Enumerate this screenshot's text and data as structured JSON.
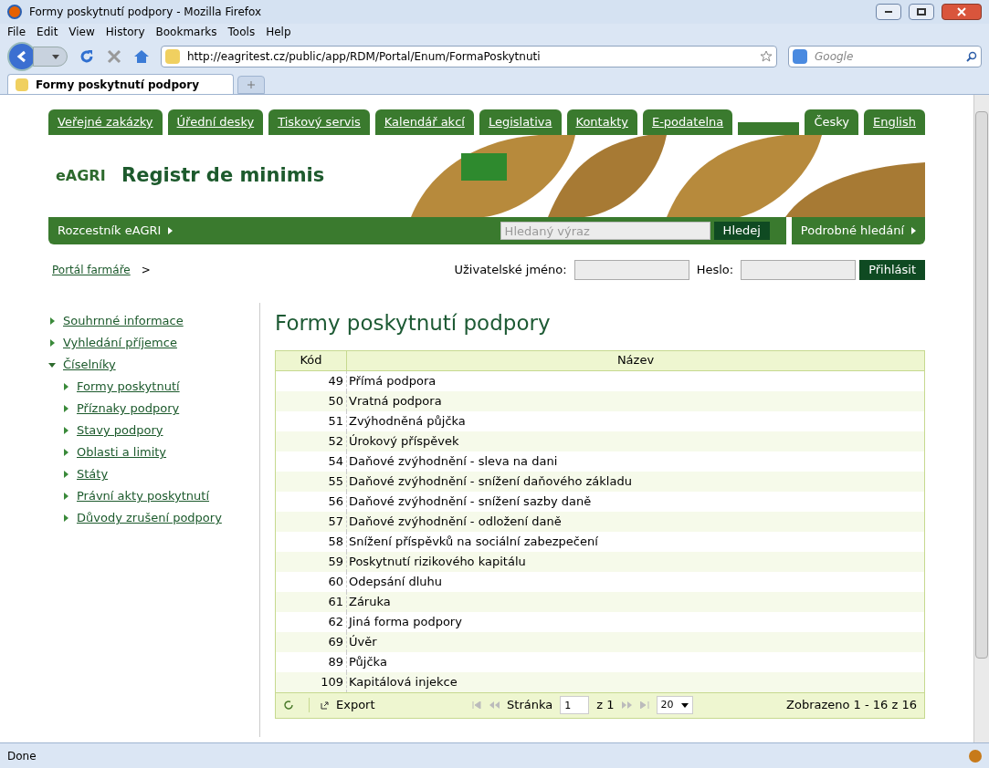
{
  "window": {
    "title": "Formy poskytnutí podpory - Mozilla Firefox"
  },
  "menu": [
    "File",
    "Edit",
    "View",
    "History",
    "Bookmarks",
    "Tools",
    "Help"
  ],
  "address_bar": {
    "value": "http://eagritest.cz/public/app/RDM/Portal/Enum/FormaPoskytnuti"
  },
  "search_bar": {
    "placeholder": "Google"
  },
  "tabs": [
    {
      "label": "Formy poskytnutí podpory",
      "selected": true
    }
  ],
  "top_nav": [
    {
      "label": "Veřejné zakázky"
    },
    {
      "label": "Úřední desky"
    },
    {
      "label": "Tiskový servis"
    },
    {
      "label": "Kalendář akcí"
    },
    {
      "label": "Legislativa"
    },
    {
      "label": "Kontakty"
    },
    {
      "label": "E-podatelna"
    }
  ],
  "languages": [
    {
      "label": "Česky",
      "selected": true
    },
    {
      "label": "English",
      "selected": false
    }
  ],
  "logo": "eAGRI",
  "site_title": "Registr de minimis",
  "rozcestnik": "Rozcestník eAGRI",
  "search": {
    "placeholder": "Hledaný výraz",
    "button": "Hledej",
    "advanced": "Podrobné hledání"
  },
  "breadcrumb": {
    "link": "Portál farmáře",
    "separator": ">"
  },
  "login": {
    "username_label": "Uživatelské jméno:",
    "password_label": "Heslo:",
    "button": "Přihlásit"
  },
  "sidebar": {
    "items": [
      {
        "label": "Souhrnné informace",
        "expanded": false
      },
      {
        "label": "Vyhledání příjemce",
        "expanded": false
      },
      {
        "label": "Číselníky",
        "expanded": true,
        "children": [
          {
            "label": "Formy poskytnutí",
            "expanded": false
          },
          {
            "label": "Příznaky podpory",
            "expanded": false
          },
          {
            "label": "Stavy podpory",
            "expanded": false
          },
          {
            "label": "Oblasti a limity",
            "expanded": false
          },
          {
            "label": "Státy",
            "expanded": false
          },
          {
            "label": "Právní akty poskytnutí",
            "expanded": false
          },
          {
            "label": "Důvody zrušení podpory",
            "expanded": false
          }
        ]
      }
    ]
  },
  "heading": "Formy poskytnutí podpory",
  "table": {
    "columns": [
      "Kód",
      "Název"
    ],
    "rows": [
      [
        "49",
        "Přímá podpora"
      ],
      [
        "50",
        "Vratná podpora"
      ],
      [
        "51",
        "Zvýhodněná půjčka"
      ],
      [
        "52",
        "Úrokový příspěvek"
      ],
      [
        "54",
        "Daňové zvýhodnění - sleva na dani"
      ],
      [
        "55",
        "Daňové zvýhodnění - snížení daňového základu"
      ],
      [
        "56",
        "Daňové zvýhodnění - snížení sazby daně"
      ],
      [
        "57",
        "Daňové zvýhodnění - odložení daně"
      ],
      [
        "58",
        "Snížení příspěvků na sociální zabezpečení"
      ],
      [
        "59",
        "Poskytnutí rizikového kapitálu"
      ],
      [
        "60",
        "Odepsání dluhu"
      ],
      [
        "61",
        "Záruka"
      ],
      [
        "62",
        "Jiná forma podpory"
      ],
      [
        "69",
        "Úvěr"
      ],
      [
        "89",
        "Půjčka"
      ],
      [
        "109",
        "Kapitálová injekce"
      ]
    ]
  },
  "pager": {
    "export": "Export",
    "page_label": "Stránka",
    "page": "1",
    "of": "z 1",
    "page_size": "20",
    "summary": "Zobrazeno 1 - 16 z 16"
  },
  "status_bar": "Done"
}
